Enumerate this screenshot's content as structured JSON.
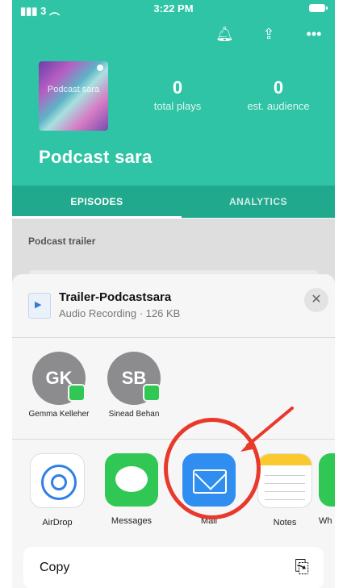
{
  "status_bar": {
    "carrier": "3",
    "time": "3:22 PM"
  },
  "toolbar": {
    "bell_icon": "bell-icon",
    "share_icon": "share-icon",
    "more_icon": "more-icon"
  },
  "podcast": {
    "cover_text": "Podcast sara",
    "name": "Podcast sara",
    "total_plays_value": "0",
    "total_plays_label": "total plays",
    "audience_value": "0",
    "audience_label": "est. audience"
  },
  "tabs": [
    {
      "label": "EPISODES",
      "active": true
    },
    {
      "label": "ANALYTICS",
      "active": false
    }
  ],
  "episodes_section": {
    "heading": "Podcast trailer"
  },
  "share_sheet": {
    "file_name": "Trailer-Podcastsara",
    "file_meta": "Audio Recording · 126 KB",
    "contacts": [
      {
        "initials": "GK",
        "name": "Gemma Kelleher"
      },
      {
        "initials": "SB",
        "name": "Sinead Behan"
      }
    ],
    "apps": [
      {
        "label": "AirDrop"
      },
      {
        "label": "Messages"
      },
      {
        "label": "Mail"
      },
      {
        "label": "Notes"
      },
      {
        "label": "Wh"
      }
    ],
    "copy_label": "Copy"
  },
  "colors": {
    "teal": "#2ec4a5",
    "teal_dark": "#21a98e",
    "annotation_red": "#e8392b"
  }
}
